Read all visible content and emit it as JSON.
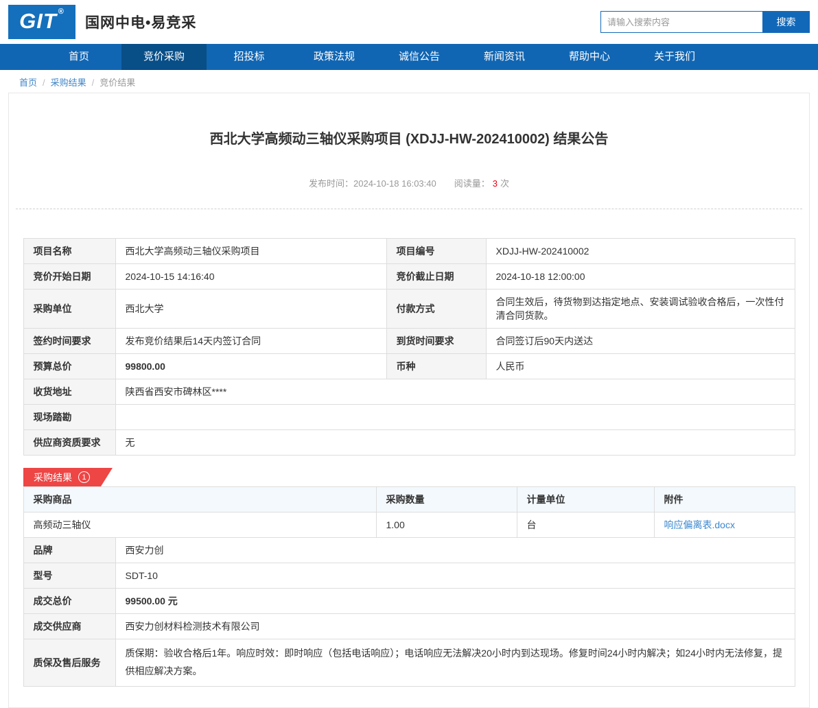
{
  "colors": {
    "nav_blue": "#1166b3",
    "nav_active_blue": "#084e87",
    "logo_blue": "#1470bc",
    "price_red": "#e60113",
    "badge_red": "#ee4545",
    "link_blue": "#3a87ce"
  },
  "header": {
    "logo_text": "GIT",
    "logo_reg": "®",
    "site_title": "国网中电•易竞采",
    "search": {
      "placeholder": "请输入搜索内容",
      "button_label": "搜索"
    }
  },
  "nav": {
    "items": [
      {
        "label": "首页"
      },
      {
        "label": "竞价采购",
        "active": true
      },
      {
        "label": "招投标"
      },
      {
        "label": "政策法规"
      },
      {
        "label": "诚信公告"
      },
      {
        "label": "新闻资讯"
      },
      {
        "label": "帮助中心"
      },
      {
        "label": "关于我们"
      }
    ]
  },
  "breadcrumb": {
    "home": "首页",
    "section": "采购结果",
    "current": "竞价结果",
    "separator": "/"
  },
  "article": {
    "title": "西北大学高频动三轴仪采购项目 (XDJJ-HW-202410002) 结果公告",
    "publish_label": "发布时间：",
    "publish_time": "2024-10-18 16:03:40",
    "views_label": "阅读量：",
    "views_count": "3",
    "views_unit": "次"
  },
  "info_table": {
    "rows": [
      {
        "l1": "项目名称",
        "v1": "西北大学高频动三轴仪采购项目",
        "l2": "项目编号",
        "v2": "XDJJ-HW-202410002"
      },
      {
        "l1": "竞价开始日期",
        "v1": "2024-10-15 14:16:40",
        "l2": "竞价截止日期",
        "v2": "2024-10-18 12:00:00"
      },
      {
        "l1": "采购单位",
        "v1": "西北大学",
        "l2": "付款方式",
        "v2": "合同生效后，待货物到达指定地点、安装调试验收合格后，一次性付清合同货款。"
      },
      {
        "l1": "签约时间要求",
        "v1": "发布竞价结果后14天内签订合同",
        "l2": "到货时间要求",
        "v2": "合同签订后90天内送达"
      },
      {
        "l1": "预算总价",
        "v1": "99800.00",
        "l2": "币种",
        "v2": "人民币"
      }
    ],
    "full_rows": [
      {
        "label": "收货地址",
        "value": "陕西省西安市碑林区****"
      },
      {
        "label": "现场踏勘",
        "value": ""
      },
      {
        "label": "供应商资质要求",
        "value": "无"
      }
    ]
  },
  "result_section": {
    "badge_label": "采购结果",
    "badge_count": "1",
    "product_table": {
      "headers": [
        "采购商品",
        "采购数量",
        "计量单位",
        "附件"
      ],
      "row": {
        "product": "高频动三轴仪",
        "quantity": "1.00",
        "unit": "台",
        "attachment": "响应偏离表.docx"
      }
    },
    "details": [
      {
        "label": "品牌",
        "value": "西安力创"
      },
      {
        "label": "型号",
        "value": "SDT-10"
      },
      {
        "label": "成交总价",
        "value": "99500.00 元"
      },
      {
        "label": "成交供应商",
        "value": "西安力创材料检测技术有限公司"
      },
      {
        "label": "质保及售后服务",
        "value": "质保期：验收合格后1年。响应时效：即时响应（包括电话响应）；电话响应无法解决20小时内到达现场。修复时间24小时内解决；如24小时内无法修复，提供相应解决方案。"
      }
    ]
  }
}
